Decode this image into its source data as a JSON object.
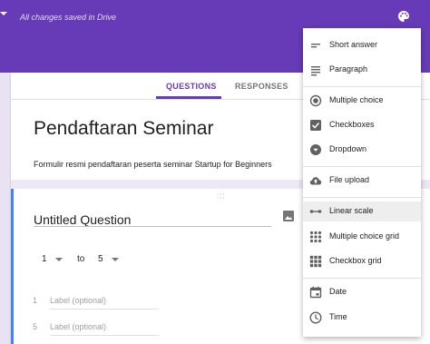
{
  "header": {
    "saved_status": "All changes saved in Drive"
  },
  "tabs": [
    {
      "label": "QUESTIONS",
      "active": true
    },
    {
      "label": "RESPONSES",
      "active": false
    }
  ],
  "form": {
    "title": "Pendaftaran Seminar",
    "description": "Formulir resmi pendaftaran peserta seminar Startup for Beginners"
  },
  "question": {
    "title": "Untitled Question",
    "scale_min": "1",
    "scale_to": "to",
    "scale_max": "5",
    "labels": [
      {
        "num": "1",
        "placeholder": "Label (optional)"
      },
      {
        "num": "5",
        "placeholder": "Label (optional)"
      }
    ]
  },
  "type_menu": {
    "items": [
      {
        "label": "Short answer",
        "icon": "short-answer-icon"
      },
      {
        "label": "Paragraph",
        "icon": "paragraph-icon"
      },
      {
        "label": "Multiple choice",
        "icon": "radio-icon"
      },
      {
        "label": "Checkboxes",
        "icon": "checkbox-icon"
      },
      {
        "label": "Dropdown",
        "icon": "dropdown-icon"
      },
      {
        "label": "File upload",
        "icon": "cloud-upload-icon"
      },
      {
        "label": "Linear scale",
        "icon": "linear-scale-icon",
        "selected": true
      },
      {
        "label": "Multiple choice grid",
        "icon": "grid-dots-icon"
      },
      {
        "label": "Checkbox grid",
        "icon": "grid-squares-icon"
      },
      {
        "label": "Date",
        "icon": "calendar-icon"
      },
      {
        "label": "Time",
        "icon": "clock-icon"
      }
    ]
  },
  "colors": {
    "brand": "#673ab7",
    "focus_bar": "#4285f4"
  }
}
